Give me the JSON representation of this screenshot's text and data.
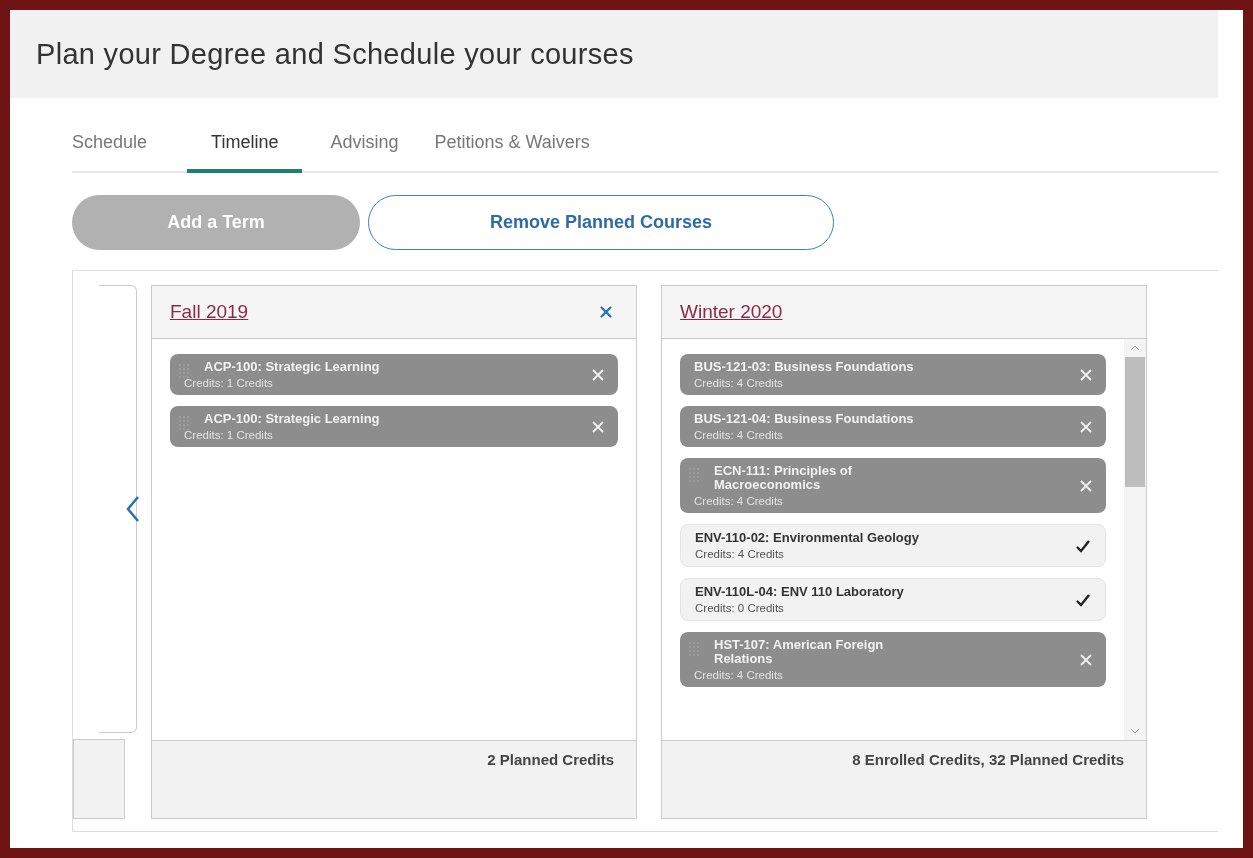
{
  "page_title": "Plan your Degree and Schedule your courses",
  "tabs": [
    {
      "label": "Schedule",
      "selected": false
    },
    {
      "label": "Timeline",
      "selected": true
    },
    {
      "label": "Advising",
      "selected": false
    },
    {
      "label": "Petitions & Waivers",
      "selected": false
    }
  ],
  "actions": [
    {
      "label": "Add a Term",
      "disabled": true
    },
    {
      "label": "Remove Planned Courses",
      "disabled": false
    }
  ],
  "terms": [
    {
      "name": "Fall 2019",
      "removable": true,
      "scrollbar": false,
      "footer": "2 Planned Credits",
      "courses": [
        {
          "kind": "planned",
          "handle": true,
          "title": "ACP-100: Strategic Learning",
          "credits": "Credits: 1 Credits"
        },
        {
          "kind": "planned",
          "handle": true,
          "title": "ACP-100: Strategic Learning",
          "credits": "Credits: 1 Credits"
        }
      ]
    },
    {
      "name": "Winter 2020",
      "removable": false,
      "scrollbar": true,
      "footer": "8 Enrolled Credits, 32 Planned Credits",
      "courses": [
        {
          "kind": "planned",
          "handle": false,
          "title": "BUS-121-03: Business Foundations",
          "credits": "Credits: 4 Credits"
        },
        {
          "kind": "planned",
          "handle": false,
          "title": "BUS-121-04: Business Foundations",
          "credits": "Credits: 4 Credits"
        },
        {
          "kind": "planned",
          "handle": true,
          "title": "ECN-111: Principles of Macroeconomics",
          "credits": "Credits: 4 Credits"
        },
        {
          "kind": "enrolled",
          "handle": false,
          "title": "ENV-110-02: Environmental Geology",
          "credits": "Credits: 4 Credits"
        },
        {
          "kind": "enrolled",
          "handle": false,
          "title": "ENV-110L-04: ENV 110 Laboratory",
          "credits": "Credits: 0 Credits"
        },
        {
          "kind": "planned",
          "handle": true,
          "title": "HST-107: American Foreign Relations",
          "credits": "Credits: 4 Credits"
        }
      ]
    }
  ]
}
